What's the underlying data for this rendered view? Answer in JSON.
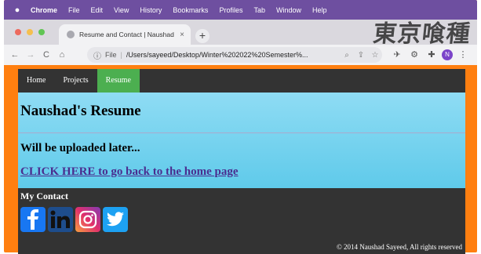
{
  "menubar": {
    "app": "Chrome",
    "items": [
      "File",
      "Edit",
      "View",
      "History",
      "Bookmarks",
      "Profiles",
      "Tab",
      "Window",
      "Help"
    ]
  },
  "tab": {
    "title": "Resume and Contact | Naushad",
    "close": "×"
  },
  "newtab": "+",
  "overlay_text": "東京喰種",
  "toolbar": {
    "back": "←",
    "forward": "→",
    "reload": "C",
    "home": "⌂",
    "file_label": "File",
    "url": "/Users/sayeed/Desktop/Winter%202022%20Semester%...",
    "profile_initial": "N"
  },
  "page": {
    "nav": [
      "Home",
      "Projects",
      "Resume"
    ],
    "active_nav": "Resume",
    "heading": "Naushad's Resume",
    "subheading": "Will be uploaded later...",
    "back_link": "CLICK HERE to go back to the home page",
    "contact_title": "My Contact",
    "socials": [
      "facebook",
      "linkedin",
      "instagram",
      "twitter"
    ],
    "footer": "© 2014 Naushad Sayeed, All rights reserved"
  },
  "colors": {
    "menubar": "#6e4fa0",
    "border": "#ff7f10",
    "nav_active": "#4caf50",
    "hero_top": "#8fdcf4",
    "hero_bottom": "#5fcaea",
    "page_bg": "#333333",
    "link": "#4a2d8f"
  }
}
